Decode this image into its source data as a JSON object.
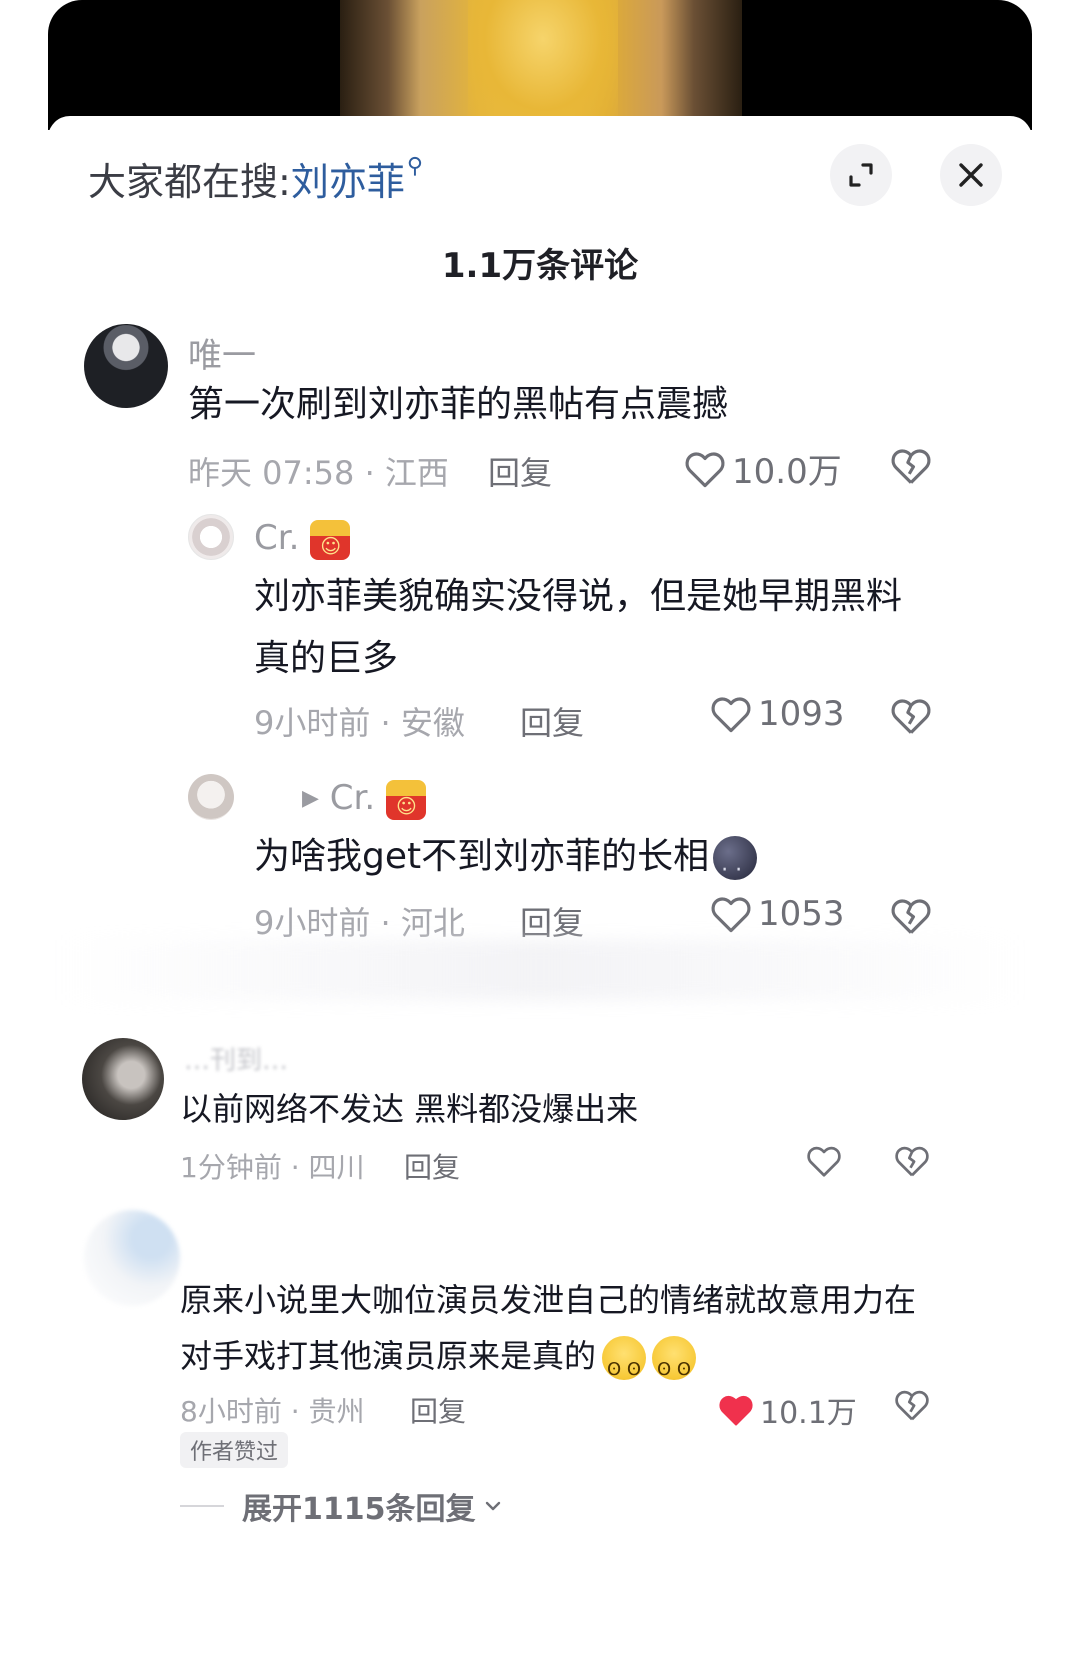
{
  "header": {
    "search_prefix": "大家都在搜:",
    "search_keyword": "刘亦菲",
    "comments_count": "1.1万条评论"
  },
  "comments": [
    {
      "username": "唯一",
      "text": "第一次刷到刘亦菲的黑帖有点震撼",
      "meta": "昨天 07:58 · 江西",
      "reply_label": "回复",
      "likes": "10.0万"
    },
    {
      "username": "Cr.",
      "text": "刘亦菲美貌确实没得说，但是她早期黑料真的巨多",
      "meta": "9小时前 · 安徽",
      "reply_label": "回复",
      "likes": "1093"
    },
    {
      "reply_to": "Cr.",
      "text": "为啥我get不到刘亦菲的长相",
      "meta": "9小时前 · 河北",
      "reply_label": "回复",
      "likes": "1053"
    },
    {
      "username": "…刊到…",
      "text": "以前网络不发达 黑料都没爆出来",
      "meta": "1分钟前 · 四川",
      "reply_label": "回复",
      "likes": ""
    },
    {
      "text": "原来小说里大咖位演员发泄自己的情绪就故意用力在对手戏打其他演员原来是真的",
      "meta": "8小时前 · 贵州",
      "reply_label": "回复",
      "likes": "10.1万",
      "liked": true,
      "author_liked": "作者赞过",
      "expand_replies": "展开1115条回复"
    }
  ],
  "colors": {
    "like_active": "#f0314d",
    "search_keyword": "#2e5d9e",
    "meta_text": "#a6a7ad"
  },
  "icons": [
    "search-icon",
    "expand-icon",
    "close-icon",
    "heart-icon",
    "broken-heart-icon",
    "fries-emoji",
    "moon-emoji",
    "pleading-emoji",
    "chevron-down-icon",
    "play-triangle-icon"
  ]
}
